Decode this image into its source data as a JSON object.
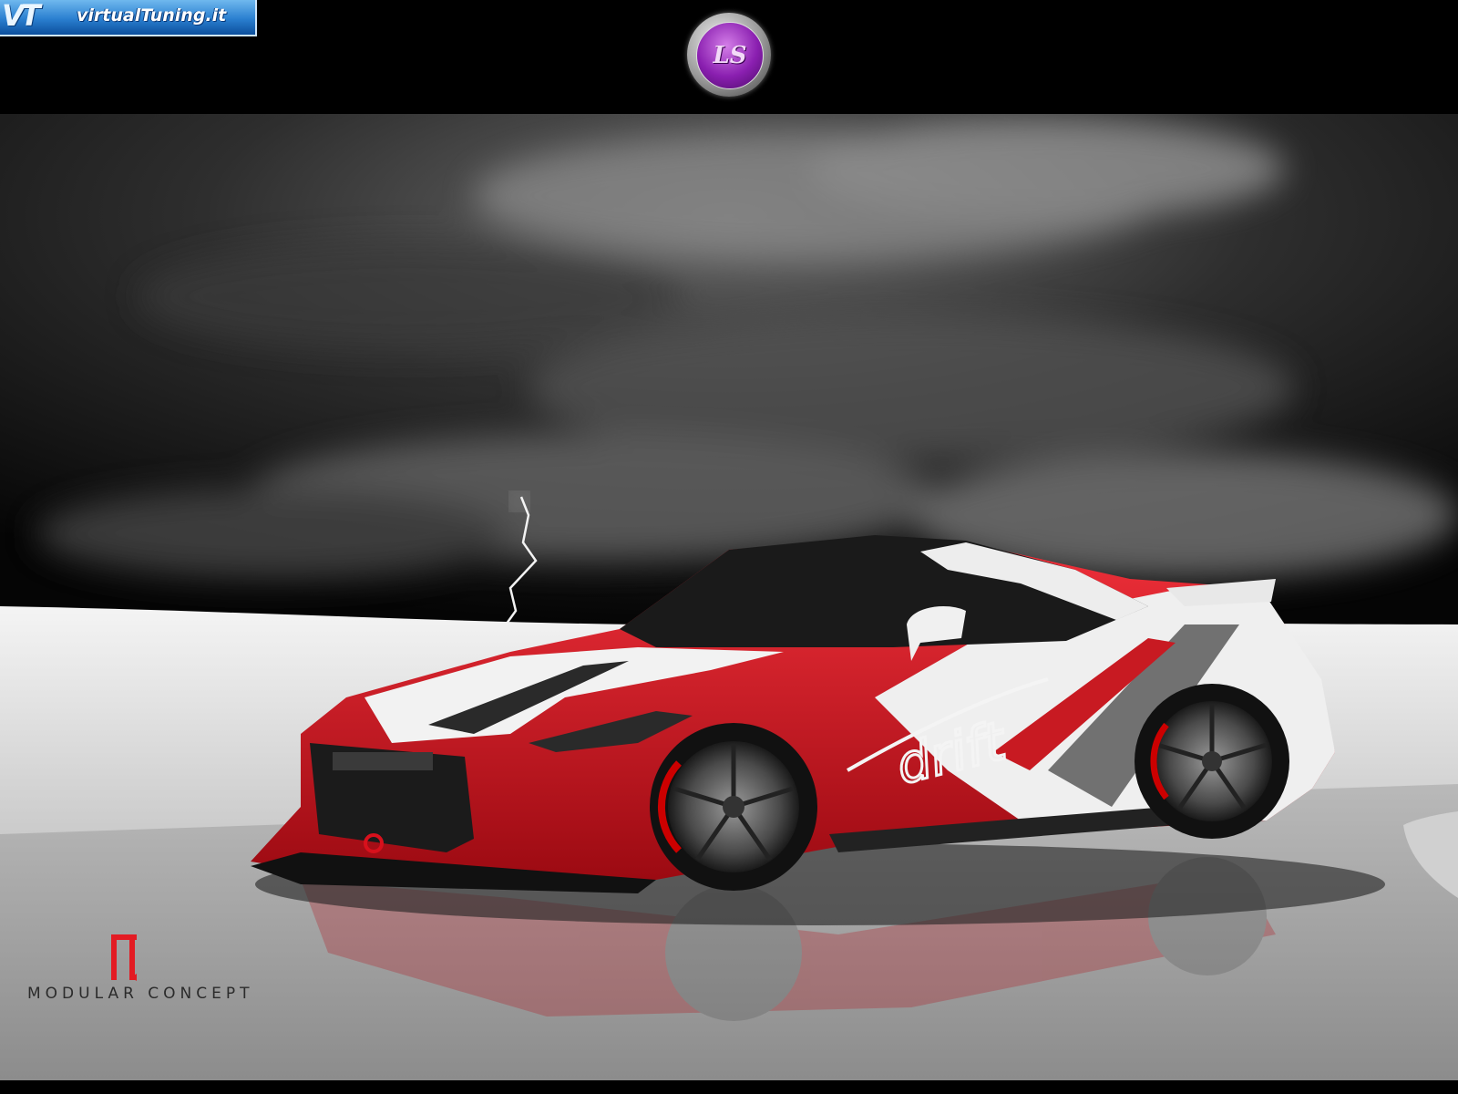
{
  "header": {
    "site_logo_mark": "VT",
    "site_logo_text": "virtualTuning.it",
    "author_badge_text": "LS"
  },
  "car": {
    "livery_text": "drift"
  },
  "brand": {
    "logo_mark": "M",
    "caption": "MODULAR CONCEPT"
  },
  "colors": {
    "car_red": "#d8101c",
    "car_white": "#f2f2f2",
    "sky_dark": "#1c1c1c",
    "badge_purple": "#8a1fb0",
    "site_blue": "#2a7fd0"
  }
}
